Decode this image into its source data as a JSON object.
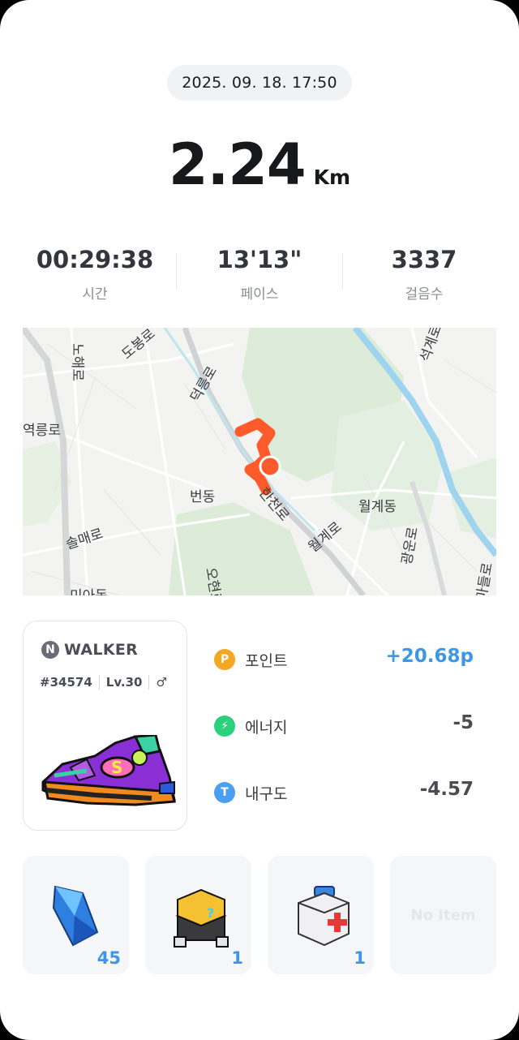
{
  "record": {
    "datetime": "2025. 09. 18. 17:50",
    "distance_value": "2.24",
    "distance_unit": "Km"
  },
  "stats": [
    {
      "value": "00:29:38",
      "label": "시간"
    },
    {
      "value": "13'13\"",
      "label": "페이스"
    },
    {
      "value": "3337",
      "label": "걸음수"
    }
  ],
  "map": {
    "labels": [
      "도봉로",
      "노해로",
      "덕릉로",
      "석계로",
      "역릉로",
      "번동",
      "한천로",
      "월계동",
      "솔매로",
      "월계로",
      "광운로",
      "미아동",
      "오현로",
      "마들로"
    ],
    "route_color": "#ff5a2b"
  },
  "shoe": {
    "brand_letter": "N",
    "name": "WALKER",
    "id": "#34574",
    "level": "Lv.30",
    "gender_symbol": "♂",
    "icon": "sneaker-illustration"
  },
  "rewards": [
    {
      "label": "포인트",
      "value": "+20.68p",
      "icon": "point-coin-icon",
      "icon_text": "P",
      "color": "#f5a623"
    },
    {
      "label": "에너지",
      "value": "-5",
      "icon": "energy-bolt-icon",
      "icon_text": "⚡",
      "color": "#2ccf7a"
    },
    {
      "label": "내구도",
      "value": "-4.57",
      "icon": "durability-icon",
      "icon_text": "T",
      "color": "#4a9ff0"
    }
  ],
  "items": [
    {
      "name": "blue-crystal",
      "count": "45"
    },
    {
      "name": "mystery-box",
      "count": "1"
    },
    {
      "name": "repair-kit",
      "count": "1"
    },
    {
      "name": "empty-slot",
      "empty_text": "No Item"
    }
  ],
  "colors": {
    "accent_blue": "#3d97e8",
    "text_dark": "#17181a",
    "muted": "#8a8d93"
  }
}
